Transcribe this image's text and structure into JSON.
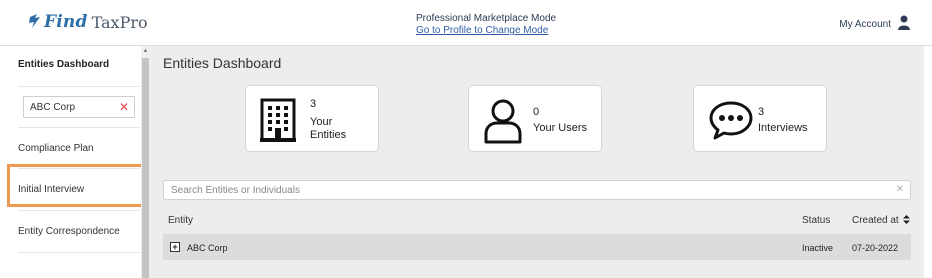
{
  "header": {
    "logo_find": "Find",
    "logo_rest": "TaxPro",
    "mode_text": "Professional Marketplace Mode",
    "mode_link": "Go to Profile to Change Mode",
    "account_label": "My Account"
  },
  "sidebar": {
    "title": "Entities Dashboard",
    "entity_search_value": "ABC Corp",
    "items": [
      {
        "label": "Compliance Plan"
      },
      {
        "label": "Initial Interview"
      },
      {
        "label": "Entity Correspondence"
      }
    ]
  },
  "main": {
    "title": "Entities Dashboard",
    "cards": [
      {
        "count": "3",
        "label_line1": "Your",
        "label_line2": "Entities",
        "icon": "building-icon"
      },
      {
        "count": "0",
        "label_line1": "Your Users",
        "label_line2": "",
        "icon": "user-outline-icon"
      },
      {
        "count": "3",
        "label_line1": "Interviews",
        "label_line2": "",
        "icon": "chat-bubble-icon"
      }
    ],
    "search_placeholder": "Search Entities or Individuals",
    "table": {
      "columns": {
        "entity": "Entity",
        "status": "Status",
        "created": "Created at"
      },
      "rows": [
        {
          "entity": "ABC Corp",
          "status": "Inactive",
          "created": "07-20-2022"
        }
      ]
    }
  },
  "colors": {
    "brand_blue": "#2f6fa8",
    "highlight_orange": "#ef9950",
    "clear_red": "#e04848"
  }
}
